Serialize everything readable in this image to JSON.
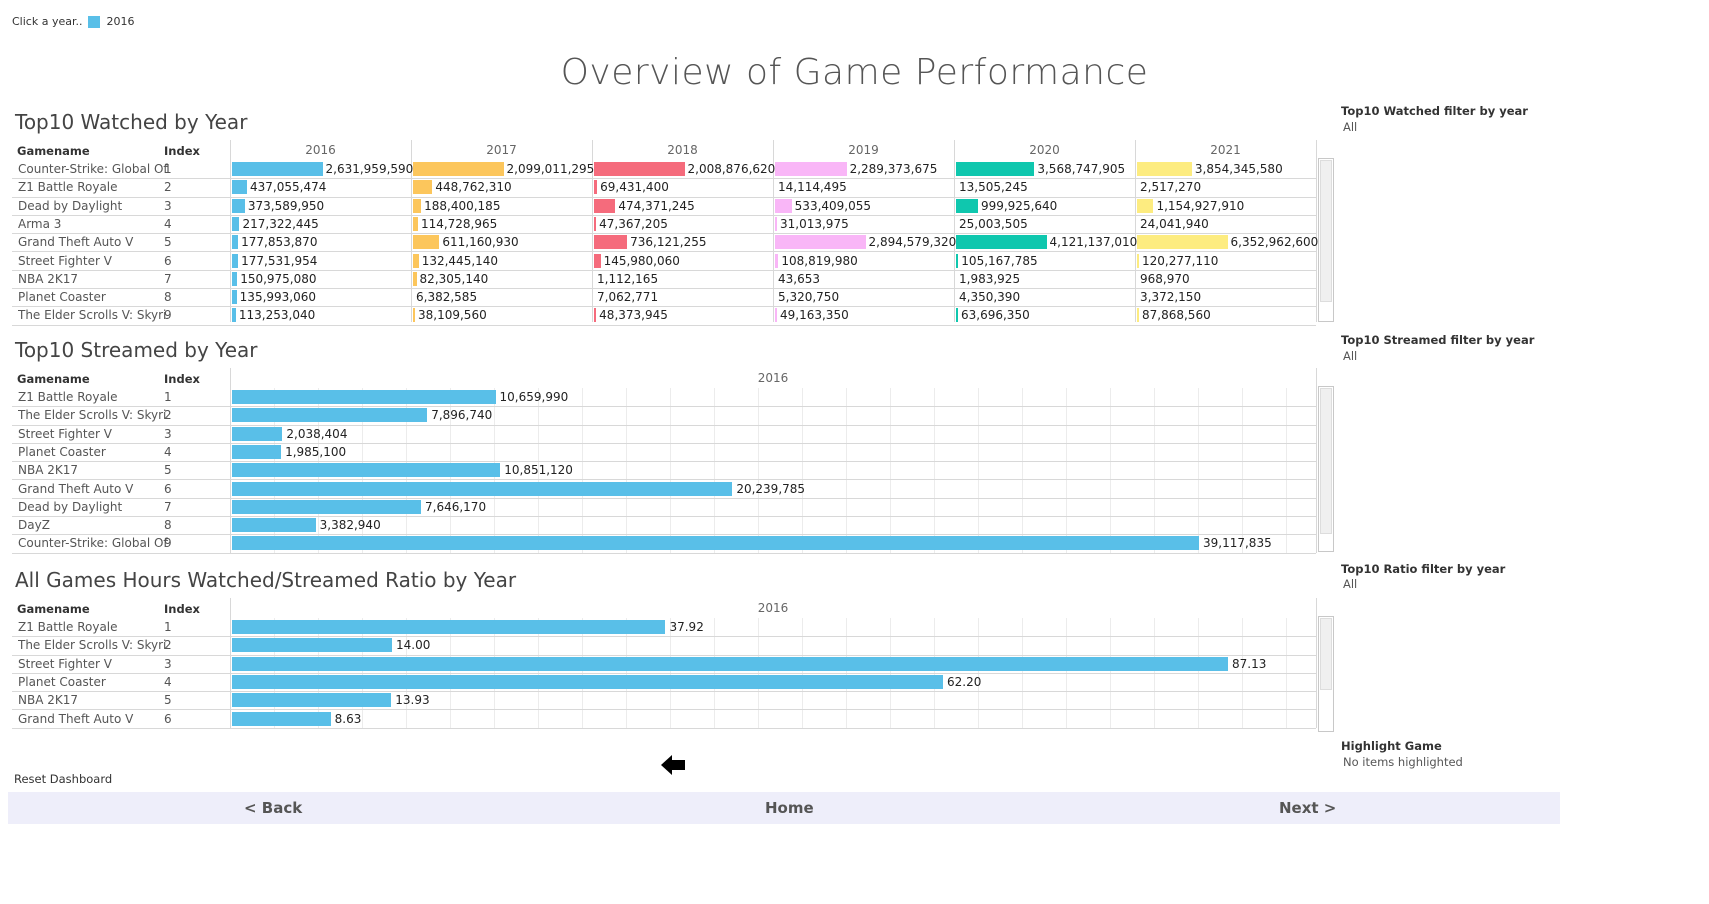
{
  "legend": {
    "prompt": "Click a year..",
    "year": "2016",
    "color": "#59bfe8"
  },
  "title": "Overview of Game Performance",
  "watched": {
    "title": "Top10 Watched by Year",
    "col_gamename": "Gamename",
    "col_index": "Index",
    "years": [
      "2016",
      "2017",
      "2018",
      "2019",
      "2020",
      "2021"
    ],
    "colors": [
      "#59bfe8",
      "#fcc65c",
      "#f56b7c",
      "#f9b6f7",
      "#0fc7ae",
      "#fdec80"
    ],
    "rows": [
      {
        "name": "Counter-Strike: Global Off..",
        "index": "1",
        "values": [
          "2,631,959,590",
          "2,099,011,295",
          "2,008,876,620",
          "2,289,373,675",
          "3,568,747,905",
          "3,854,345,580"
        ],
        "nums": [
          2631959590,
          2099011295,
          2008876620,
          2289373675,
          3568747905,
          3854345580
        ]
      },
      {
        "name": "Z1 Battle Royale",
        "index": "2",
        "values": [
          "437,055,474",
          "448,762,310",
          "69,431,400",
          "14,114,495",
          "13,505,245",
          "2,517,270"
        ],
        "nums": [
          437055474,
          448762310,
          69431400,
          14114495,
          13505245,
          2517270
        ]
      },
      {
        "name": "Dead by Daylight",
        "index": "3",
        "values": [
          "373,589,950",
          "188,400,185",
          "474,371,245",
          "533,409,055",
          "999,925,640",
          "1,154,927,910"
        ],
        "nums": [
          373589950,
          188400185,
          474371245,
          533409055,
          999925640,
          1154927910
        ]
      },
      {
        "name": "Arma 3",
        "index": "4",
        "values": [
          "217,322,445",
          "114,728,965",
          "47,367,205",
          "31,013,975",
          "25,003,505",
          "24,041,940"
        ],
        "nums": [
          217322445,
          114728965,
          47367205,
          31013975,
          25003505,
          24041940
        ]
      },
      {
        "name": "Grand Theft Auto V",
        "index": "5",
        "values": [
          "177,853,870",
          "611,160,930",
          "736,121,255",
          "2,894,579,320",
          "4,121,137,010",
          "6,352,962,600"
        ],
        "nums": [
          177853870,
          611160930,
          736121255,
          2894579320,
          4121137010,
          6352962600
        ]
      },
      {
        "name": "Street Fighter V",
        "index": "6",
        "values": [
          "177,531,954",
          "132,445,140",
          "145,980,060",
          "108,819,980",
          "105,167,785",
          "120,277,110"
        ],
        "nums": [
          177531954,
          132445140,
          145980060,
          108819980,
          105167785,
          120277110
        ]
      },
      {
        "name": "NBA 2K17",
        "index": "7",
        "values": [
          "150,975,080",
          "82,305,140",
          "1,112,165",
          "43,653",
          "1,983,925",
          "968,970"
        ],
        "nums": [
          150975080,
          82305140,
          1112165,
          43653,
          1983925,
          968970
        ]
      },
      {
        "name": "Planet Coaster",
        "index": "8",
        "values": [
          "135,993,060",
          "6,382,585",
          "7,062,771",
          "5,320,750",
          "4,350,390",
          "3,372,150"
        ],
        "nums": [
          135993060,
          6382585,
          7062771,
          5320750,
          4350390,
          3372150
        ]
      },
      {
        "name": "The Elder Scrolls V: Skyri..",
        "index": "9",
        "values": [
          "113,253,040",
          "38,109,560",
          "48,373,945",
          "49,163,350",
          "63,696,350",
          "87,868,560"
        ],
        "nums": [
          113253040,
          38109560,
          48373945,
          49163350,
          63696350,
          87868560
        ]
      }
    ]
  },
  "streamed": {
    "title": "Top10 Streamed by Year",
    "col_gamename": "Gamename",
    "col_index": "Index",
    "year": "2016",
    "color": "#59bfe8",
    "rows": [
      {
        "name": "Z1 Battle Royale",
        "index": "1",
        "value": "10,659,990",
        "num": 10659990
      },
      {
        "name": "The Elder Scrolls V: Skyri..",
        "index": "2",
        "value": "7,896,740",
        "num": 7896740
      },
      {
        "name": "Street Fighter V",
        "index": "3",
        "value": "2,038,404",
        "num": 2038404
      },
      {
        "name": "Planet Coaster",
        "index": "4",
        "value": "1,985,100",
        "num": 1985100
      },
      {
        "name": "NBA 2K17",
        "index": "5",
        "value": "10,851,120",
        "num": 10851120
      },
      {
        "name": "Grand Theft Auto V",
        "index": "6",
        "value": "20,239,785",
        "num": 20239785
      },
      {
        "name": "Dead by Daylight",
        "index": "7",
        "value": "7,646,170",
        "num": 7646170
      },
      {
        "name": "DayZ",
        "index": "8",
        "value": "3,382,940",
        "num": 3382940
      },
      {
        "name": "Counter-Strike: Global Off..",
        "index": "9",
        "value": "39,117,835",
        "num": 39117835
      }
    ]
  },
  "ratio": {
    "title": "All Games Hours Watched/Streamed Ratio by Year",
    "col_gamename": "Gamename",
    "col_index": "Index",
    "year": "2016",
    "color": "#59bfe8",
    "rows": [
      {
        "name": "Z1 Battle Royale",
        "index": "1",
        "value": "37.92",
        "num": 37.92
      },
      {
        "name": "The Elder Scrolls V: Skyri..",
        "index": "2",
        "value": "14.00",
        "num": 14.0
      },
      {
        "name": "Street Fighter V",
        "index": "3",
        "value": "87.13",
        "num": 87.13
      },
      {
        "name": "Planet Coaster",
        "index": "4",
        "value": "62.20",
        "num": 62.2
      },
      {
        "name": "NBA 2K17",
        "index": "5",
        "value": "13.93",
        "num": 13.93
      },
      {
        "name": "Grand Theft Auto V",
        "index": "6",
        "value": "8.63",
        "num": 8.63
      }
    ]
  },
  "filters": {
    "watched": {
      "title": "Top10 Watched filter by year",
      "value": "All"
    },
    "streamed": {
      "title": "Top10 Streamed filter by year",
      "value": "All"
    },
    "ratio": {
      "title": "Top10 Ratio filter by year",
      "value": "All"
    },
    "highlight": {
      "title": "Highlight Game",
      "value": "No items highlighted"
    }
  },
  "reset_label": "Reset Dashboard",
  "footer": {
    "back": "< Back",
    "home": "Home",
    "next": "Next >"
  },
  "icons": {
    "back_arrow": "left-arrow-icon"
  }
}
